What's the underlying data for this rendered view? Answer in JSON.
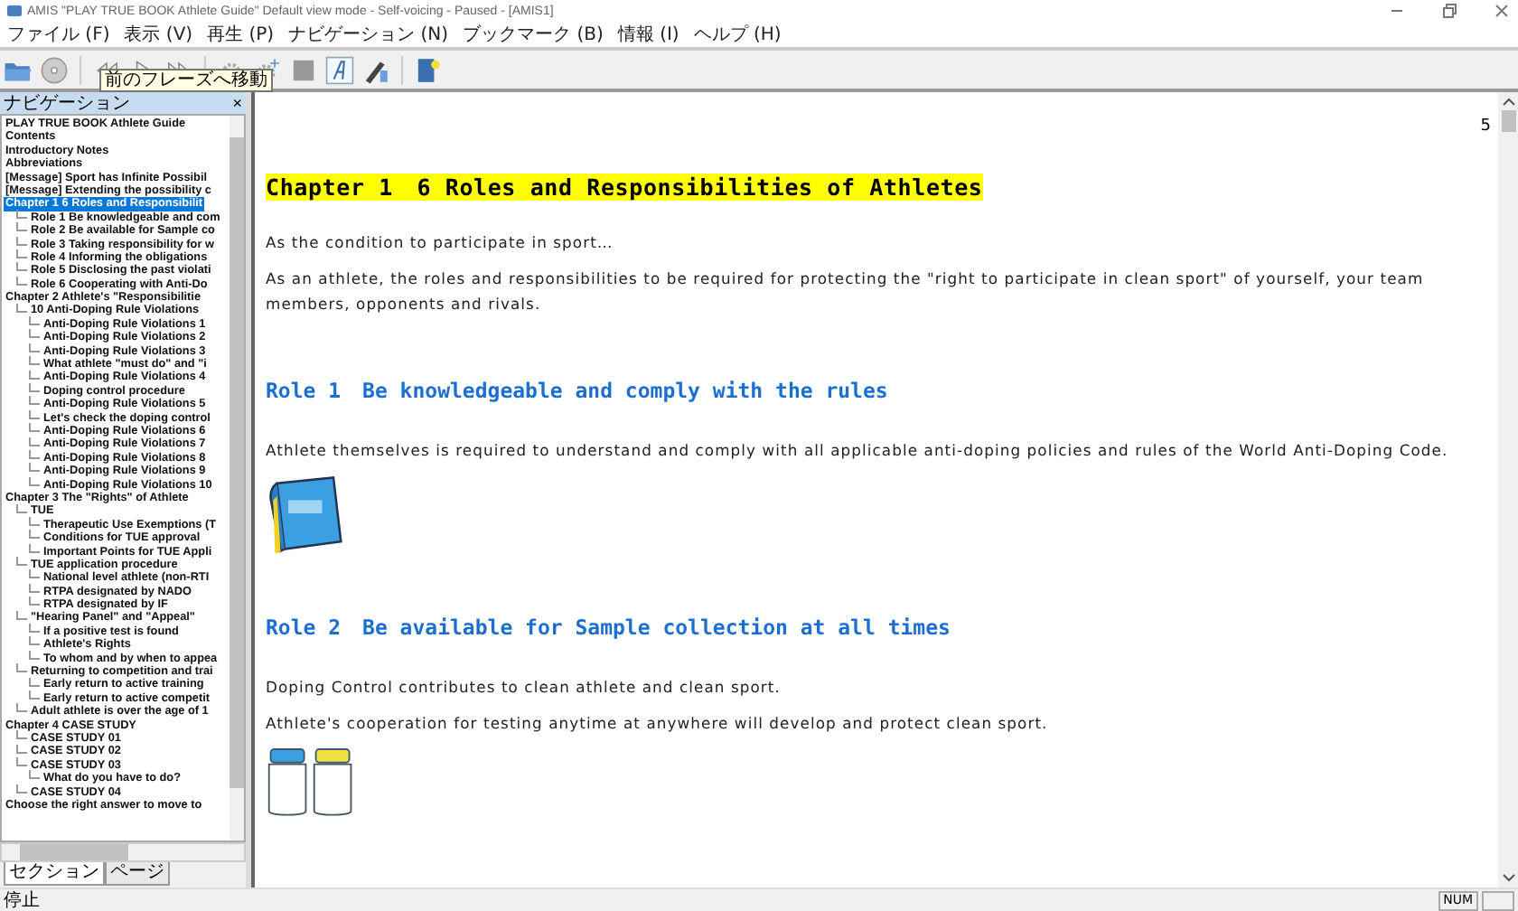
{
  "window": {
    "title": "AMIS \"PLAY TRUE BOOK Athlete Guide\" Default view mode - Self-voicing - Paused - [AMIS1]"
  },
  "menu": [
    "ファイル (F)",
    "表示 (V)",
    "再生 (P)",
    "ナビゲーション (N)",
    "ブックマーク (B)",
    "情報 (I)",
    "ヘルプ (H)"
  ],
  "toolbar": {
    "tooltip": "前のフレーズへ移動"
  },
  "navigation": {
    "title": "ナビゲーション",
    "close": "×",
    "items": [
      {
        "label": "PLAY TRUE BOOK  Athlete Guide",
        "selected": false
      },
      {
        "label": "Contents",
        "selected": false
      },
      {
        "label": "Introductory Notes",
        "selected": false
      },
      {
        "label": "Abbreviations",
        "selected": false
      },
      {
        "label": "[Message] Sport has Infinite Possibil",
        "selected": false
      },
      {
        "label": "[Message] Extending the possibility c",
        "selected": false
      },
      {
        "label": "Chapter 1  6 Roles and Responsibilit",
        "selected": true,
        "children": [
          {
            "label": "Role 1  Be knowledgeable and com",
            "selected": false
          },
          {
            "label": "Role 2  Be available for Sample co",
            "selected": false
          },
          {
            "label": "Role 3  Taking responsibility for w",
            "selected": false
          },
          {
            "label": "Role 4  Informing the obligations",
            "selected": false
          },
          {
            "label": "Role 5  Disclosing the past violati",
            "selected": false
          },
          {
            "label": "Role 6  Cooperating with Anti-Do",
            "selected": false
          }
        ]
      },
      {
        "label": "Chapter 2  Athlete's \"Responsibilitie",
        "selected": false,
        "children": [
          {
            "label": "10 Anti-Doping Rule Violations",
            "selected": false,
            "children": [
              {
                "label": "Anti-Doping Rule Violations 1",
                "selected": false
              },
              {
                "label": "Anti-Doping Rule Violations 2",
                "selected": false
              },
              {
                "label": "Anti-Doping Rule Violations 3",
                "selected": false
              },
              {
                "label": "What athlete \"must do\" and \"i",
                "selected": false
              },
              {
                "label": "Anti-Doping Rule Violations 4",
                "selected": false
              },
              {
                "label": "Doping control procedure",
                "selected": false
              },
              {
                "label": "Anti-Doping Rule Violations 5",
                "selected": false
              },
              {
                "label": "Let's check the doping control",
                "selected": false
              },
              {
                "label": "Anti-Doping Rule Violations 6",
                "selected": false
              },
              {
                "label": "Anti-Doping Rule Violations 7",
                "selected": false
              },
              {
                "label": "Anti-Doping Rule Violations 8",
                "selected": false
              },
              {
                "label": "Anti-Doping Rule Violations 9",
                "selected": false
              },
              {
                "label": "Anti-Doping Rule Violations 10",
                "selected": false
              }
            ]
          }
        ]
      },
      {
        "label": "Chapter 3  The \"Rights\" of Athlete",
        "selected": false,
        "children": [
          {
            "label": "TUE",
            "selected": false,
            "children": [
              {
                "label": "Therapeutic Use Exemptions (T",
                "selected": false
              },
              {
                "label": "Conditions for TUE approval",
                "selected": false
              },
              {
                "label": "Important Points for TUE Appli",
                "selected": false
              }
            ]
          },
          {
            "label": "TUE application procedure",
            "selected": false,
            "children": [
              {
                "label": "National level athlete (non-RTI",
                "selected": false
              },
              {
                "label": "RTPA designated by NADO",
                "selected": false
              },
              {
                "label": "RTPA designated by IF",
                "selected": false
              }
            ]
          },
          {
            "label": "\"Hearing Panel\" and \"Appeal\"",
            "selected": false,
            "children": [
              {
                "label": "If a positive test is found",
                "selected": false
              },
              {
                "label": "Athlete's Rights",
                "selected": false
              },
              {
                "label": "To whom and by when to appea",
                "selected": false
              }
            ]
          },
          {
            "label": "Returning to competition and trai",
            "selected": false,
            "children": [
              {
                "label": "Early return to active training",
                "selected": false
              },
              {
                "label": "Early return to active competit",
                "selected": false
              }
            ]
          },
          {
            "label": "Adult athlete is over the age of 1",
            "selected": false
          }
        ]
      },
      {
        "label": "Chapter 4  CASE STUDY",
        "selected": false,
        "children": [
          {
            "label": "CASE STUDY 01",
            "selected": false
          },
          {
            "label": "CASE STUDY 02",
            "selected": false
          },
          {
            "label": "CASE STUDY 03",
            "selected": false,
            "children": [
              {
                "label": "What do you have to do?",
                "selected": false
              }
            ]
          },
          {
            "label": "CASE STUDY 04",
            "selected": false
          }
        ]
      },
      {
        "label": "Choose the right answer to move to",
        "selected": false
      }
    ]
  },
  "sidebar_tabs": [
    {
      "label": "セクション",
      "selected": true
    },
    {
      "label": "ページ",
      "selected": false
    }
  ],
  "content": {
    "page_number": "5",
    "blocks": [
      {
        "kind": "chapter",
        "text": "Chapter 1　6 Roles and Responsibilities of Athletes"
      },
      {
        "kind": "para",
        "text": "As the condition to participate in sport…"
      },
      {
        "kind": "para",
        "text": "As an athlete, the roles and responsibilities to be required for protecting the \"right to participate in clean sport\" of yourself, your team members, opponents and rivals."
      },
      {
        "kind": "role",
        "text": "Role 1　Be knowledgeable and comply with the rules"
      },
      {
        "kind": "para",
        "text": "Athlete themselves is required to understand and comply with all applicable anti-doping policies and rules of the World Anti-Doping Code."
      },
      {
        "kind": "book"
      },
      {
        "kind": "role",
        "text": "Role 2　Be available for Sample collection at all times"
      },
      {
        "kind": "para",
        "text": "Doping Control contributes to clean athlete and clean sport."
      },
      {
        "kind": "para",
        "text": "Athlete's cooperation for testing anytime at anywhere will develop and protect clean sport."
      },
      {
        "kind": "bottles"
      }
    ]
  },
  "status_bar": {
    "text": "停止",
    "indicator": "NUM"
  }
}
